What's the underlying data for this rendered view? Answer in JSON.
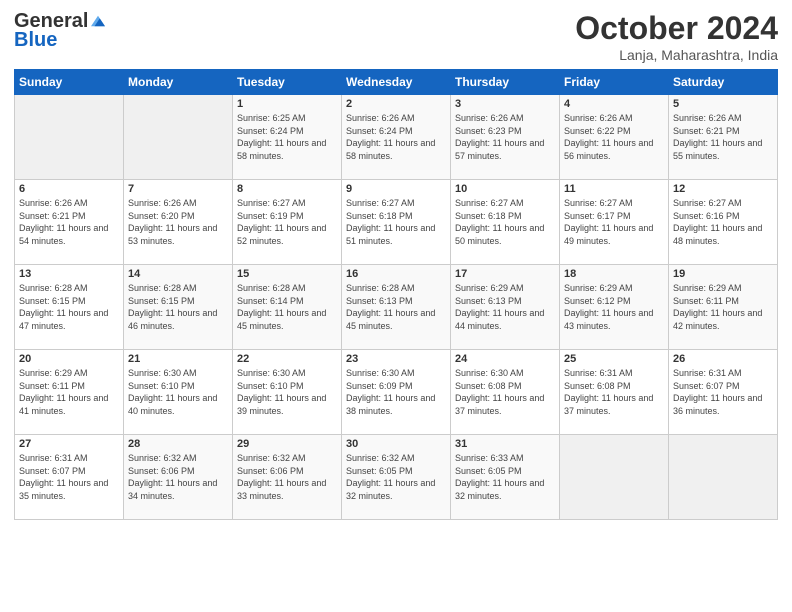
{
  "header": {
    "logo_general": "General",
    "logo_blue": "Blue",
    "month_title": "October 2024",
    "location": "Lanja, Maharashtra, India"
  },
  "weekdays": [
    "Sunday",
    "Monday",
    "Tuesday",
    "Wednesday",
    "Thursday",
    "Friday",
    "Saturday"
  ],
  "weeks": [
    [
      {
        "day": "",
        "info": ""
      },
      {
        "day": "",
        "info": ""
      },
      {
        "day": "1",
        "info": "Sunrise: 6:25 AM\nSunset: 6:24 PM\nDaylight: 11 hours and 58 minutes."
      },
      {
        "day": "2",
        "info": "Sunrise: 6:26 AM\nSunset: 6:24 PM\nDaylight: 11 hours and 58 minutes."
      },
      {
        "day": "3",
        "info": "Sunrise: 6:26 AM\nSunset: 6:23 PM\nDaylight: 11 hours and 57 minutes."
      },
      {
        "day": "4",
        "info": "Sunrise: 6:26 AM\nSunset: 6:22 PM\nDaylight: 11 hours and 56 minutes."
      },
      {
        "day": "5",
        "info": "Sunrise: 6:26 AM\nSunset: 6:21 PM\nDaylight: 11 hours and 55 minutes."
      }
    ],
    [
      {
        "day": "6",
        "info": "Sunrise: 6:26 AM\nSunset: 6:21 PM\nDaylight: 11 hours and 54 minutes."
      },
      {
        "day": "7",
        "info": "Sunrise: 6:26 AM\nSunset: 6:20 PM\nDaylight: 11 hours and 53 minutes."
      },
      {
        "day": "8",
        "info": "Sunrise: 6:27 AM\nSunset: 6:19 PM\nDaylight: 11 hours and 52 minutes."
      },
      {
        "day": "9",
        "info": "Sunrise: 6:27 AM\nSunset: 6:18 PM\nDaylight: 11 hours and 51 minutes."
      },
      {
        "day": "10",
        "info": "Sunrise: 6:27 AM\nSunset: 6:18 PM\nDaylight: 11 hours and 50 minutes."
      },
      {
        "day": "11",
        "info": "Sunrise: 6:27 AM\nSunset: 6:17 PM\nDaylight: 11 hours and 49 minutes."
      },
      {
        "day": "12",
        "info": "Sunrise: 6:27 AM\nSunset: 6:16 PM\nDaylight: 11 hours and 48 minutes."
      }
    ],
    [
      {
        "day": "13",
        "info": "Sunrise: 6:28 AM\nSunset: 6:15 PM\nDaylight: 11 hours and 47 minutes."
      },
      {
        "day": "14",
        "info": "Sunrise: 6:28 AM\nSunset: 6:15 PM\nDaylight: 11 hours and 46 minutes."
      },
      {
        "day": "15",
        "info": "Sunrise: 6:28 AM\nSunset: 6:14 PM\nDaylight: 11 hours and 45 minutes."
      },
      {
        "day": "16",
        "info": "Sunrise: 6:28 AM\nSunset: 6:13 PM\nDaylight: 11 hours and 45 minutes."
      },
      {
        "day": "17",
        "info": "Sunrise: 6:29 AM\nSunset: 6:13 PM\nDaylight: 11 hours and 44 minutes."
      },
      {
        "day": "18",
        "info": "Sunrise: 6:29 AM\nSunset: 6:12 PM\nDaylight: 11 hours and 43 minutes."
      },
      {
        "day": "19",
        "info": "Sunrise: 6:29 AM\nSunset: 6:11 PM\nDaylight: 11 hours and 42 minutes."
      }
    ],
    [
      {
        "day": "20",
        "info": "Sunrise: 6:29 AM\nSunset: 6:11 PM\nDaylight: 11 hours and 41 minutes."
      },
      {
        "day": "21",
        "info": "Sunrise: 6:30 AM\nSunset: 6:10 PM\nDaylight: 11 hours and 40 minutes."
      },
      {
        "day": "22",
        "info": "Sunrise: 6:30 AM\nSunset: 6:10 PM\nDaylight: 11 hours and 39 minutes."
      },
      {
        "day": "23",
        "info": "Sunrise: 6:30 AM\nSunset: 6:09 PM\nDaylight: 11 hours and 38 minutes."
      },
      {
        "day": "24",
        "info": "Sunrise: 6:30 AM\nSunset: 6:08 PM\nDaylight: 11 hours and 37 minutes."
      },
      {
        "day": "25",
        "info": "Sunrise: 6:31 AM\nSunset: 6:08 PM\nDaylight: 11 hours and 37 minutes."
      },
      {
        "day": "26",
        "info": "Sunrise: 6:31 AM\nSunset: 6:07 PM\nDaylight: 11 hours and 36 minutes."
      }
    ],
    [
      {
        "day": "27",
        "info": "Sunrise: 6:31 AM\nSunset: 6:07 PM\nDaylight: 11 hours and 35 minutes."
      },
      {
        "day": "28",
        "info": "Sunrise: 6:32 AM\nSunset: 6:06 PM\nDaylight: 11 hours and 34 minutes."
      },
      {
        "day": "29",
        "info": "Sunrise: 6:32 AM\nSunset: 6:06 PM\nDaylight: 11 hours and 33 minutes."
      },
      {
        "day": "30",
        "info": "Sunrise: 6:32 AM\nSunset: 6:05 PM\nDaylight: 11 hours and 32 minutes."
      },
      {
        "day": "31",
        "info": "Sunrise: 6:33 AM\nSunset: 6:05 PM\nDaylight: 11 hours and 32 minutes."
      },
      {
        "day": "",
        "info": ""
      },
      {
        "day": "",
        "info": ""
      }
    ]
  ]
}
